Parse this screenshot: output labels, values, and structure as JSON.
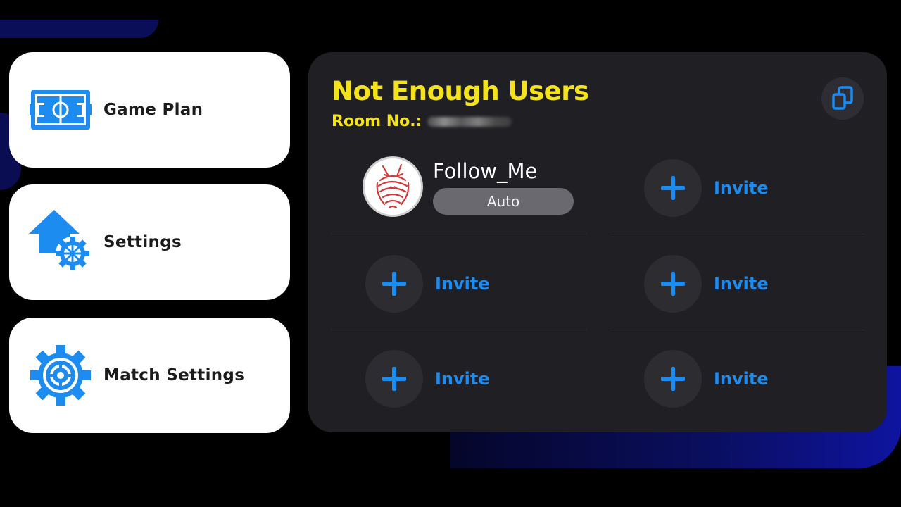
{
  "menu": {
    "items": [
      {
        "label": "Game Plan",
        "icon": "game-plan-field-icon"
      },
      {
        "label": "Settings",
        "icon": "home-gear-icon"
      },
      {
        "label": "Match Settings",
        "icon": "match-gear-icon"
      }
    ]
  },
  "panel": {
    "title": "Not Enough Users",
    "room_label": "Room No.:",
    "copy_icon": "copy-icon"
  },
  "slots": {
    "user": {
      "name": "Follow_Me",
      "badge": "Auto",
      "avatar_icon": "wolf-avatar-icon"
    },
    "invite_label": "Invite",
    "invite_icon": "plus-icon",
    "empty_slot_count_text": ""
  },
  "colors": {
    "accent_yellow": "#f4e21b",
    "accent_blue": "#1d8cf0",
    "panel_bg": "#201f24",
    "card_bg": "#ffffff"
  }
}
